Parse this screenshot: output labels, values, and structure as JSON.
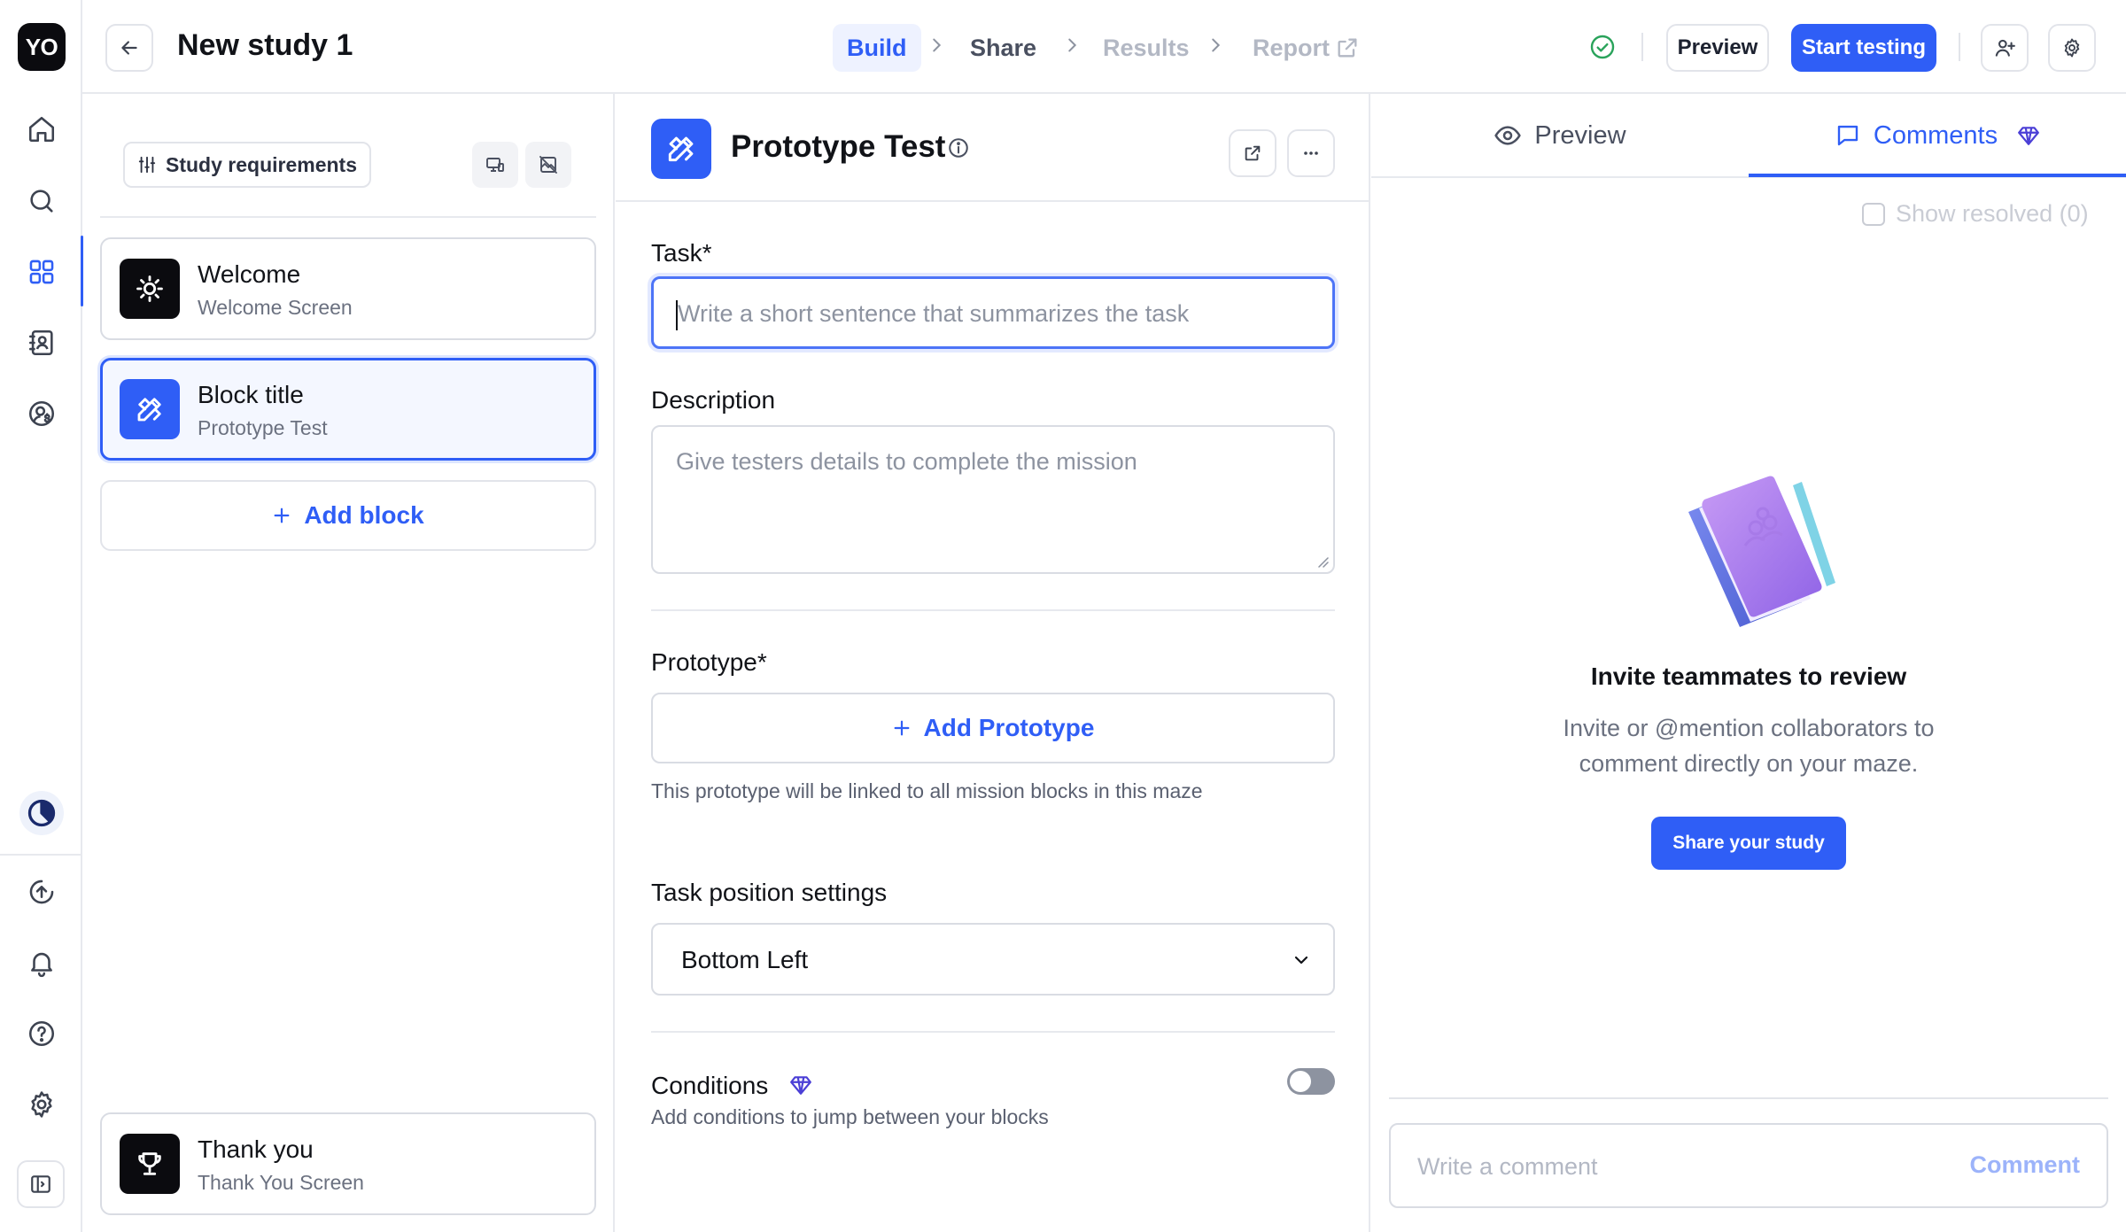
{
  "rail": {
    "logo": "YO",
    "items": [
      {
        "icon": "home-icon"
      },
      {
        "icon": "search-icon"
      },
      {
        "icon": "grid-icon",
        "active": true
      },
      {
        "icon": "contacts-icon"
      },
      {
        "icon": "user-dollar-icon"
      }
    ],
    "bottom_items": [
      {
        "icon": "clock-pie-icon"
      },
      {
        "icon": "upload-circle-icon"
      },
      {
        "icon": "bell-icon"
      },
      {
        "icon": "help-icon"
      },
      {
        "icon": "gear-icon"
      },
      {
        "icon": "sidebar-toggle-icon"
      }
    ]
  },
  "header": {
    "study_title": "New study 1",
    "steps": [
      {
        "label": "Build",
        "state": "active"
      },
      {
        "label": "Share",
        "state": "done"
      },
      {
        "label": "Results",
        "state": "disabled"
      },
      {
        "label": "Report",
        "state": "disabled"
      }
    ],
    "preview_label": "Preview",
    "start_testing_label": "Start testing",
    "accent_color": "#2f5ef6"
  },
  "blocks_panel": {
    "requirements_label": "Study requirements",
    "blocks": [
      {
        "title": "Welcome",
        "subtitle": "Welcome Screen",
        "icon": "sun-icon",
        "selected": false
      },
      {
        "title": "Block title",
        "subtitle": "Prototype Test",
        "icon": "prototype-icon",
        "selected": true
      }
    ],
    "add_block_label": "Add block",
    "end_block": {
      "title": "Thank you",
      "subtitle": "Thank You Screen",
      "icon": "trophy-icon"
    }
  },
  "editor": {
    "title": "Prototype Test",
    "task_label": "Task",
    "required_mark": "*",
    "task_placeholder": "Write a short sentence that summarizes the task",
    "description_label": "Description",
    "description_placeholder": "Give testers details to complete the mission",
    "prototype_label": "Prototype",
    "add_prototype_label": "Add Prototype",
    "prototype_helper": "This prototype will be linked to all mission blocks in this maze",
    "task_position_label": "Task position settings",
    "task_position_value": "Bottom Left",
    "conditions_label": "Conditions",
    "conditions_helper": "Add conditions to jump between your blocks",
    "conditions_enabled": false
  },
  "right_panel": {
    "tabs": [
      {
        "label": "Preview",
        "icon": "eye-icon",
        "active": false
      },
      {
        "label": "Comments",
        "icon": "comment-icon",
        "active": true
      }
    ],
    "show_resolved_label": "Show resolved (0)",
    "invite_title": "Invite teammates to review",
    "invite_text": "Invite or @mention collaborators to comment directly on your maze.",
    "share_button_label": "Share your study",
    "comment_placeholder": "Write a comment",
    "comment_button_label": "Comment"
  }
}
